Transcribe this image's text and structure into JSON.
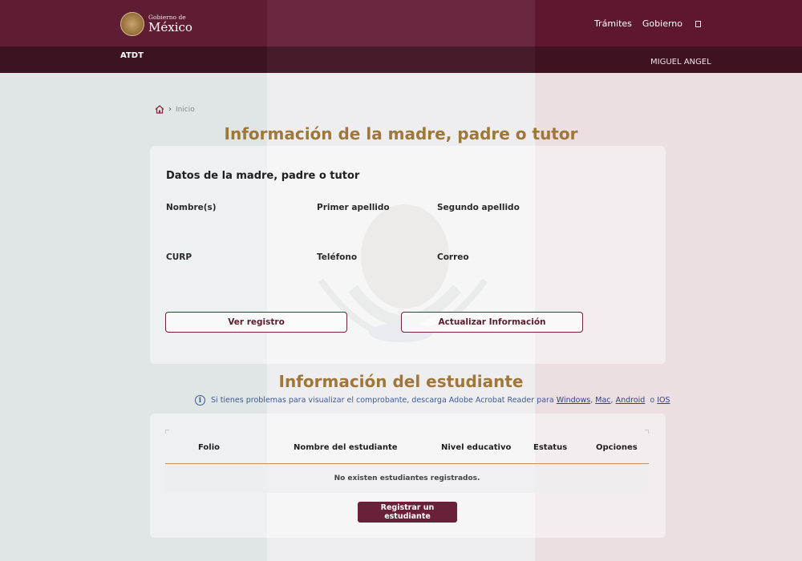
{
  "header": {
    "brand_small": "Gobierno de",
    "brand_big": "México",
    "nav": [
      "Trámites",
      "Gobierno"
    ],
    "agency": "ATDT",
    "user": "MIGUEL ANGEL"
  },
  "breadcrumb": {
    "home_label": "Inicio"
  },
  "guardian": {
    "title": "Información de la madre, padre o tutor",
    "heading": "Datos de la madre, padre o tutor",
    "fields": {
      "nombre": "Nombre(s)",
      "primer_apellido": "Primer apellido",
      "segundo_apellido": "Segundo apellido",
      "curp": "CURP",
      "telefono": "Teléfono",
      "correo": "Correo"
    },
    "buttons": {
      "ver_registro": "Ver registro",
      "actualizar": "Actualizar Información"
    }
  },
  "student": {
    "title": "Información del estudiante",
    "info_text": "Si tienes problemas para visualizar el comprobante, descarga Adobe Acrobat Reader para",
    "links": [
      "Windows",
      "Mac",
      "Android",
      "IOS"
    ],
    "link_sep1": ",",
    "link_sep2": ",",
    "link_sep3": "o",
    "table": {
      "columns": [
        "Folio",
        "Nombre del estudiante",
        "Nivel educativo",
        "Estatus",
        "Opciones"
      ],
      "empty_message": "No existen estudiantes registrados."
    },
    "register_button": "Registrar un estudiante"
  },
  "colors": {
    "guinda": "#6a2038",
    "gold": "#a0773a",
    "link_blue": "#3b5a98"
  }
}
